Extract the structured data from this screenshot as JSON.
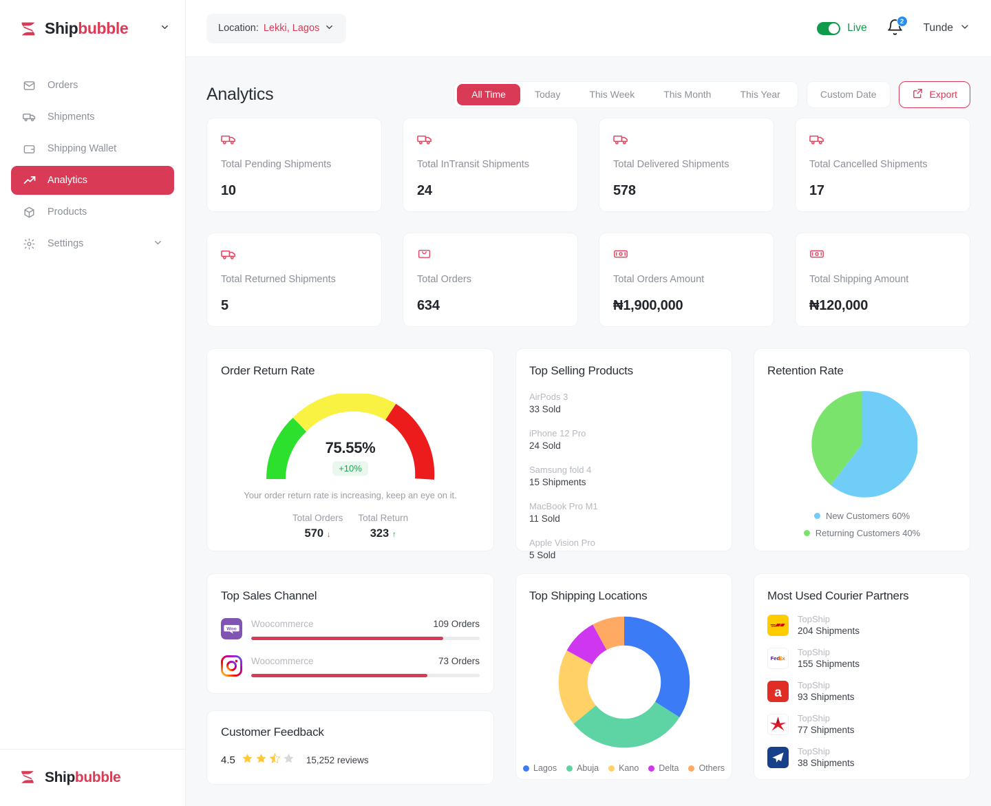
{
  "brand": {
    "name_dark": "Ship",
    "name_red": "bubble",
    "accent": "#d93a55"
  },
  "sidebar": {
    "items": [
      {
        "label": "Orders",
        "icon": "inbox-icon",
        "active": false
      },
      {
        "label": "Shipments",
        "icon": "truck-icon",
        "active": false
      },
      {
        "label": "Shipping Wallet",
        "icon": "wallet-icon",
        "active": false
      },
      {
        "label": "Analytics",
        "icon": "trending-up-icon",
        "active": true
      },
      {
        "label": "Products",
        "icon": "box-icon",
        "active": false
      },
      {
        "label": "Settings",
        "icon": "gear-icon",
        "active": false,
        "expandable": true
      }
    ]
  },
  "topbar": {
    "location_label": "Location:",
    "location_value": "Lekki, Lagos",
    "live_label": "Live",
    "live_on": true,
    "notification_count": "2",
    "user_name": "Tunde"
  },
  "page": {
    "title": "Analytics"
  },
  "filters": {
    "tabs": [
      {
        "label": "All Time",
        "active": true
      },
      {
        "label": "Today",
        "active": false
      },
      {
        "label": "This Week",
        "active": false
      },
      {
        "label": "This Month",
        "active": false
      },
      {
        "label": "This Year",
        "active": false
      }
    ],
    "custom_date_label": "Custom Date",
    "export_label": "Export"
  },
  "stats": [
    {
      "label": "Total Pending Shipments",
      "value": "10",
      "icon": "truck-icon"
    },
    {
      "label": "Total InTransit Shipments",
      "value": "24",
      "icon": "truck-icon"
    },
    {
      "label": "Total Delivered Shipments",
      "value": "578",
      "icon": "truck-icon"
    },
    {
      "label": "Total Cancelled Shipments",
      "value": "17",
      "icon": "truck-icon"
    },
    {
      "label": "Total Returned Shipments",
      "value": "5",
      "icon": "truck-icon"
    },
    {
      "label": "Total Orders",
      "value": "634",
      "icon": "shopping-bag-icon"
    },
    {
      "label": "Total Orders Amount",
      "value": "₦1,900,000",
      "icon": "banknote-icon"
    },
    {
      "label": "Total Shipping Amount",
      "value": "₦120,000",
      "icon": "banknote-icon"
    }
  ],
  "return_rate": {
    "title": "Order Return Rate",
    "percent": "75.55%",
    "delta": "+10%",
    "note": "Your order return rate is increasing, keep an eye on it.",
    "total_orders_label": "Total Orders",
    "total_orders_value": "570",
    "total_orders_trend": "down",
    "total_return_label": "Total Return",
    "total_return_value": "323",
    "total_return_trend": "up"
  },
  "top_products": {
    "title": "Top Selling Products",
    "items": [
      {
        "name": "AirPods 3",
        "sub": "33 Sold"
      },
      {
        "name": "iPhone 12 Pro",
        "sub": "24 Sold"
      },
      {
        "name": "Samsung fold 4",
        "sub": "15 Shipments"
      },
      {
        "name": "MacBook Pro M1",
        "sub": "11 Sold"
      },
      {
        "name": "Apple Vision Pro",
        "sub": "5 Sold"
      }
    ]
  },
  "retention": {
    "title": "Retention Rate",
    "legend": [
      {
        "label": "New Customers 60%",
        "color": "#6fcdf7"
      },
      {
        "label": "Returning Customers 40%",
        "color": "#7ae36b"
      }
    ]
  },
  "sales_channel": {
    "title": "Top Sales Channel",
    "rows": [
      {
        "name": "Woocommerce",
        "orders": "109 Orders",
        "percent": 84,
        "icon": "woocommerce-icon"
      },
      {
        "name": "Woocommerce",
        "orders": "73 Orders",
        "percent": 77,
        "icon": "instagram-icon"
      }
    ]
  },
  "feedback": {
    "title": "Customer Feedback",
    "rating": "4.5",
    "stars_full": 2,
    "stars_half": 1,
    "stars_empty": 1,
    "reviews": "15,252 reviews"
  },
  "shipping_locations": {
    "title": "Top Shipping Locations",
    "legend": [
      {
        "label": "Lagos",
        "color": "#3b7bf6"
      },
      {
        "label": "Abuja",
        "color": "#5ed4a4"
      },
      {
        "label": "Kano",
        "color": "#ffd166"
      },
      {
        "label": "Delta",
        "color": "#cf36f0"
      },
      {
        "label": "Others",
        "color": "#ffa963"
      }
    ]
  },
  "couriers": {
    "title": "Most Used Courier Partners",
    "rows": [
      {
        "name": "TopShip",
        "sub": "204 Shipments",
        "icon": "dhl-logo"
      },
      {
        "name": "TopShip",
        "sub": "155 Shipments",
        "icon": "fedex-logo"
      },
      {
        "name": "TopShip",
        "sub": "93 Shipments",
        "icon": "aliexpress-logo"
      },
      {
        "name": "TopShip",
        "sub": "77 Shipments",
        "icon": "star-courier-logo"
      },
      {
        "name": "TopShip",
        "sub": "38 Shipments",
        "icon": "plane-courier-logo"
      }
    ]
  },
  "chart_data": [
    {
      "type": "gauge",
      "title": "Order Return Rate",
      "value": 75.55,
      "unit": "%",
      "delta": 10,
      "range": [
        0,
        100
      ],
      "bands": [
        {
          "label": "good",
          "color": "#2ee02e",
          "from": 0,
          "to": 40
        },
        {
          "label": "warning",
          "color": "#f9f243",
          "from": 40,
          "to": 70
        },
        {
          "label": "bad",
          "color": "#ec1c1c",
          "from": 70,
          "to": 100
        }
      ],
      "annotations": [
        "Your order return rate is increasing, keep an eye on it."
      ],
      "extra": {
        "Total Orders": 570,
        "Total Return": 323
      }
    },
    {
      "type": "pie",
      "title": "Retention Rate",
      "categories": [
        "New Customers",
        "Returning Customers"
      ],
      "values": [
        60,
        40
      ],
      "colors": [
        "#6fcdf7",
        "#7ae36b"
      ],
      "legend_position": "bottom",
      "unit": "%"
    },
    {
      "type": "bar",
      "title": "Top Sales Channel",
      "orientation": "horizontal",
      "categories": [
        "Woocommerce",
        "Woocommerce"
      ],
      "values": [
        109,
        73
      ],
      "ylabel": "Orders",
      "xlim": [
        0,
        130
      ],
      "grid": false,
      "colors": [
        "#d93a55",
        "#d93a55"
      ]
    },
    {
      "type": "pie",
      "title": "Top Shipping Locations",
      "donut": true,
      "categories": [
        "Lagos",
        "Abuja",
        "Kano",
        "Delta",
        "Others"
      ],
      "values": [
        34,
        30,
        19,
        9,
        8
      ],
      "colors": [
        "#3b7bf6",
        "#5ed4a4",
        "#ffd166",
        "#cf36f0",
        "#ffa963"
      ],
      "legend_position": "bottom",
      "unit": "%"
    },
    {
      "type": "bar",
      "title": "Most Used Courier Partners",
      "orientation": "horizontal",
      "categories": [
        "TopShip",
        "TopShip",
        "TopShip",
        "TopShip",
        "TopShip"
      ],
      "values": [
        204,
        155,
        93,
        77,
        38
      ],
      "ylabel": "Shipments",
      "grid": false
    },
    {
      "type": "bar",
      "title": "Shipment & Order Totals",
      "categories": [
        "Total Pending Shipments",
        "Total InTransit Shipments",
        "Total Delivered Shipments",
        "Total Cancelled Shipments",
        "Total Returned Shipments",
        "Total Orders"
      ],
      "values": [
        10,
        24,
        578,
        17,
        5,
        634
      ],
      "grid": false
    }
  ]
}
